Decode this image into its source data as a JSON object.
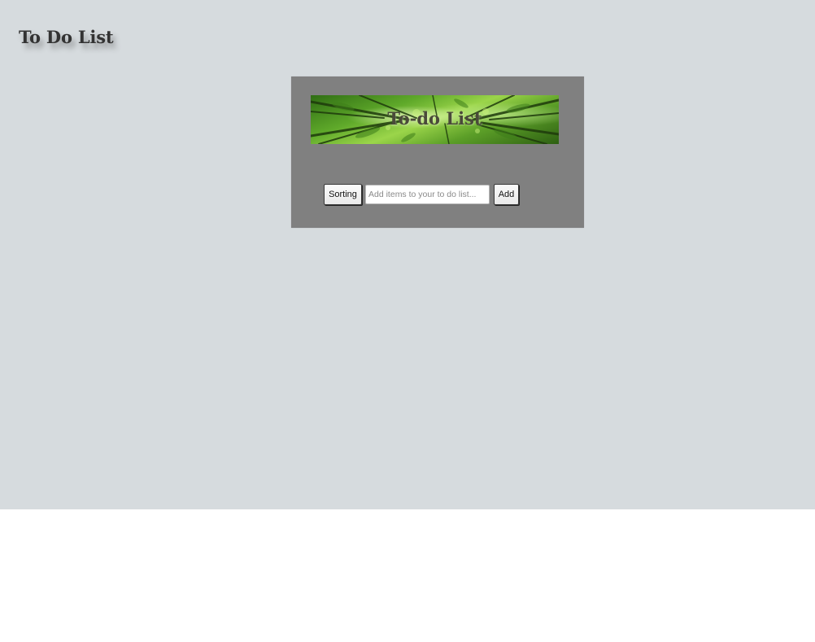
{
  "header": {
    "title": "To Do List"
  },
  "card": {
    "banner_title": "To-do List",
    "sorting_label": "Sorting",
    "input_placeholder": "Add items to your to do list...",
    "input_value": "",
    "add_label": "Add"
  },
  "colors": {
    "page_background": "#d6dbde",
    "card_background": "#808080",
    "title_text": "#333333"
  }
}
